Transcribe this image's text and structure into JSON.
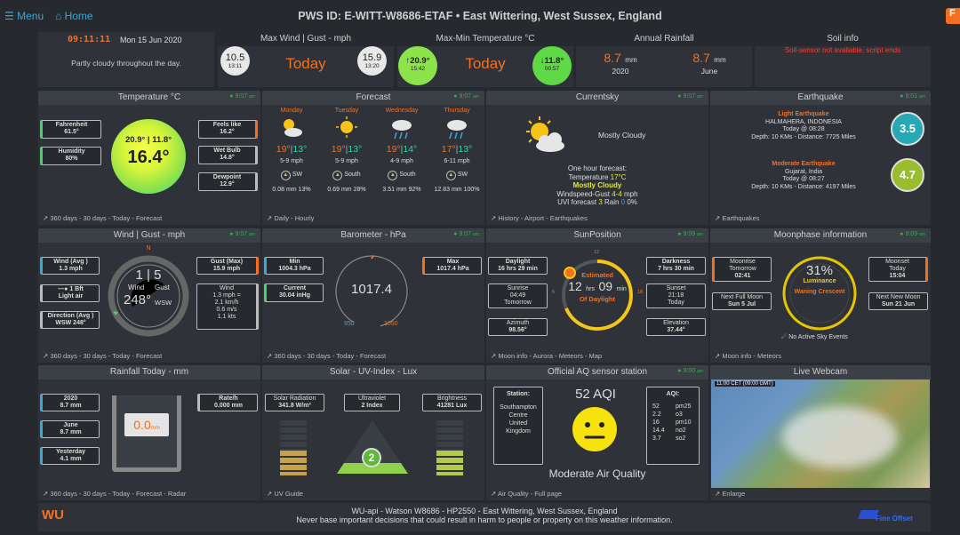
{
  "nav": {
    "menu": "Menu",
    "home": "Home",
    "title": "PWS ID: E-WITT-W8686-ETAF  •  East Wittering, West Sussex, England",
    "badge": "F"
  },
  "top": {
    "clock": "09:11:11",
    "date": "Mon 15 Jun 2020",
    "forecast": "Partly cloudy throughout the day.",
    "wind": {
      "title": "Max Wind | Gust - mph",
      "lo": "10.5",
      "lo_t": "13:11",
      "hi": "15.9",
      "hi_t": "13:20",
      "label": "Today"
    },
    "temp": {
      "title": "Max-Min Temperature °C",
      "hi": "↑20.9°",
      "hi_t": "15:42",
      "lo": "↓11.8°",
      "lo_t": "00:57",
      "label": "Today"
    },
    "rain": {
      "title": "Annual Rainfall",
      "v1": "8.7",
      "u1": "mm",
      "y1": "2020",
      "v2": "8.7",
      "u2": "mm",
      "y2": "June"
    },
    "soil": {
      "title": "Soil info",
      "msg": "Soil-sensor not available, script ends"
    }
  },
  "temperature": {
    "title": "Temperature °C",
    "time": "9:07",
    "fahrenheit": "Fahrenheit",
    "f_val": "61.5°",
    "humidity": "Humidity",
    "h_val": "80%",
    "feels": "Feels like",
    "feels_val": "16.2°",
    "wetbulb": "Wet Bulb",
    "wb_val": "14.8°",
    "dewpoint": "Dewpoint",
    "dp_val": "12.9°",
    "minmax": "20.9° | 11.8°",
    "current": "16.4°",
    "foot": "360 days - 30 days - Today - Forecast"
  },
  "forecast": {
    "title": "Forecast",
    "time": "9:07",
    "days": [
      {
        "day": "Monday",
        "hi": "19°",
        "lo": "13°",
        "wind": "5-9 mph",
        "dir": "SW",
        "rain": "0.08 mm 13%"
      },
      {
        "day": "Tuesday",
        "hi": "19°",
        "lo": "13°",
        "wind": "5-9 mph",
        "dir": "South",
        "rain": "0.69 mm 28%"
      },
      {
        "day": "Wednesday",
        "hi": "19°",
        "lo": "14°",
        "wind": "4-9 mph",
        "dir": "South",
        "rain": "3.51 mm 92%"
      },
      {
        "day": "Thursday",
        "hi": "17°",
        "lo": "13°",
        "wind": "6-11 mph",
        "dir": "SW",
        "rain": "12.83 mm 100%"
      }
    ],
    "foot": "Daily - Hourly"
  },
  "currentsky": {
    "title": "Currentsky",
    "time": "9:07",
    "cond": "Mostly Cloudy",
    "l1": "One hour forecast:",
    "l2a": "Temperature ",
    "l2b": "17°C",
    "l3": "Mostly Cloudy",
    "l4a": "Windspeed-Gust ",
    "l4b": "4-4",
    "l4c": " mph",
    "l5a": "UVI forecast ",
    "l5b": "3",
    "l5c": "  Rain ",
    "l5d": "0",
    "l5e": " 0%",
    "foot": "History - Airport - Earthquakes"
  },
  "earthquake": {
    "title": "Earthquake",
    "time": "9:01",
    "q1": {
      "type": "Light Earthquake",
      "place": "HALMAHERA, INDONESIA",
      "when": "Today @ 08:28",
      "dist": "Depth: 10 KMs - Distance: 7725 Miles",
      "mag": "3.5"
    },
    "q2": {
      "type": "Moderate Earthquake",
      "place": "Gujarat, India",
      "when": "Today @ 08:27",
      "dist": "Depth: 10 KMs - Distance: 4197 Miles",
      "mag": "4.7"
    },
    "foot": "Earthquakes"
  },
  "wind": {
    "title": "Wind | Gust - mph",
    "time": "9:07",
    "avg": "Wind (Avg )",
    "avg_v": "1.3 mph",
    "bft": "1 Bft",
    "bft_v": "Light air",
    "dir": "Direction (Avg )",
    "dir_v": "WSW 248°",
    "gust": "Gust (Max)",
    "gust_v": "15.9 mph",
    "wlab": "Wind",
    "w1": "1.3 mph =",
    "w2": "2.1 km/h",
    "w3": "0.6 m/s",
    "w4": "1.1 kts",
    "n": "N",
    "speed": "1 | 5",
    "wl": "Wind",
    "gl": "Gust",
    "deg": "248°",
    "dirtxt": "WSW",
    "foot": "360 days - 30 days - Today - Forecast"
  },
  "baro": {
    "title": "Barometer - hPa",
    "time": "9:07",
    "min": "Min",
    "min_v": "1004.3 hPa",
    "cur": "Current",
    "cur_v": "30.04 inHg",
    "max": "Max",
    "max_v": "1017.4 hPa",
    "val": "1017.4",
    "lo": "950",
    "hi": "1050",
    "foot": "360 days - 30 days - Today - Forecast"
  },
  "sun": {
    "title": "SunPosition",
    "time": "9:09",
    "day": "Daylight",
    "day_v": "16 hrs 29 min",
    "rise": "Sunrise",
    "rise_v": "04:49",
    "rise_d": "Tomorrow",
    "az": "Azimuth",
    "az_v": "98.56°",
    "dark": "Darkness",
    "dark_v": "7 hrs 30 min",
    "set": "Sunset",
    "set_v": "21:18",
    "set_d": "Today",
    "el": "Elevation",
    "el_v": "37.44°",
    "est": "Estimated",
    "h": "12",
    "hl": "hrs",
    "m": "09",
    "ml": "min",
    "of": "Of Daylight",
    "t12": "12",
    "t6": "6",
    "t18": "18",
    "foot": "Moon info - Aurora - Meteors - Map"
  },
  "moon": {
    "title": "Moonphase information",
    "time": "9:09",
    "rise": "Moonrise",
    "rise_d": "Tomorrow",
    "rise_v": "02:41",
    "full": "Next Full Moon",
    "full_v": "Sun 5 Jul",
    "set": "Moonset",
    "set_d": "Today",
    "set_v": "15:04",
    "new": "Next New Moon",
    "new_v": "Sun 21 Jun",
    "pct": "31%",
    "lum": "Luminance",
    "phase": "Waning Crescent",
    "sky": "No Active Sky Events",
    "foot": "Moon info - Meteors"
  },
  "rainfall": {
    "title": "Rainfall Today - mm",
    "y": "2020",
    "y_v": "8.7 mm",
    "m": "June",
    "m_v": "8.7 mm",
    "yd": "Yesterday",
    "yd_v": "4.1 mm",
    "rate": "Rate/h",
    "rate_v": "0.000 mm",
    "val": "0.0",
    "unit": "mm",
    "foot": "360 days - 30 days - Today - Forecast - Radar"
  },
  "solar": {
    "title": "Solar - UV-Index - Lux",
    "sr": "Solar Radiation",
    "sr_v": "341.8 W/m²",
    "uv": "Ultraviolet",
    "uv_v": "2 Index",
    "br": "Brightness",
    "br_v": "41281 Lux",
    "uvi": "2",
    "foot": "UV Guide"
  },
  "aq": {
    "title": "Official AQ sensor station",
    "time": "9:00",
    "station": "Station:",
    "s1": "Southampton",
    "s2": "Centre",
    "s3": "United",
    "s4": "Kingdom",
    "aqi": "52 AQI",
    "aqil": "AQI:",
    "rows": [
      [
        "52",
        "pm25"
      ],
      [
        "2.2",
        "o3"
      ],
      [
        "16",
        "pm10"
      ],
      [
        "14.4",
        "no2"
      ],
      [
        "3.7",
        "so2"
      ]
    ],
    "quality": "Moderate Air Quality",
    "foot": "Air Quality  -  Full page"
  },
  "webcam": {
    "title": "Live Webcam",
    "stamp": "11:00 CET (09:00 GMT)",
    "foot": "Enlarge"
  },
  "footer": {
    "l1": "WU-api  -  Watson W8686 - HP2550  -  East Wittering, West Sussex, England",
    "l2": "Never base important decisions that could result in harm to people or property on this weather information.",
    "brand": "Fine Offset",
    "wu": "WU"
  }
}
